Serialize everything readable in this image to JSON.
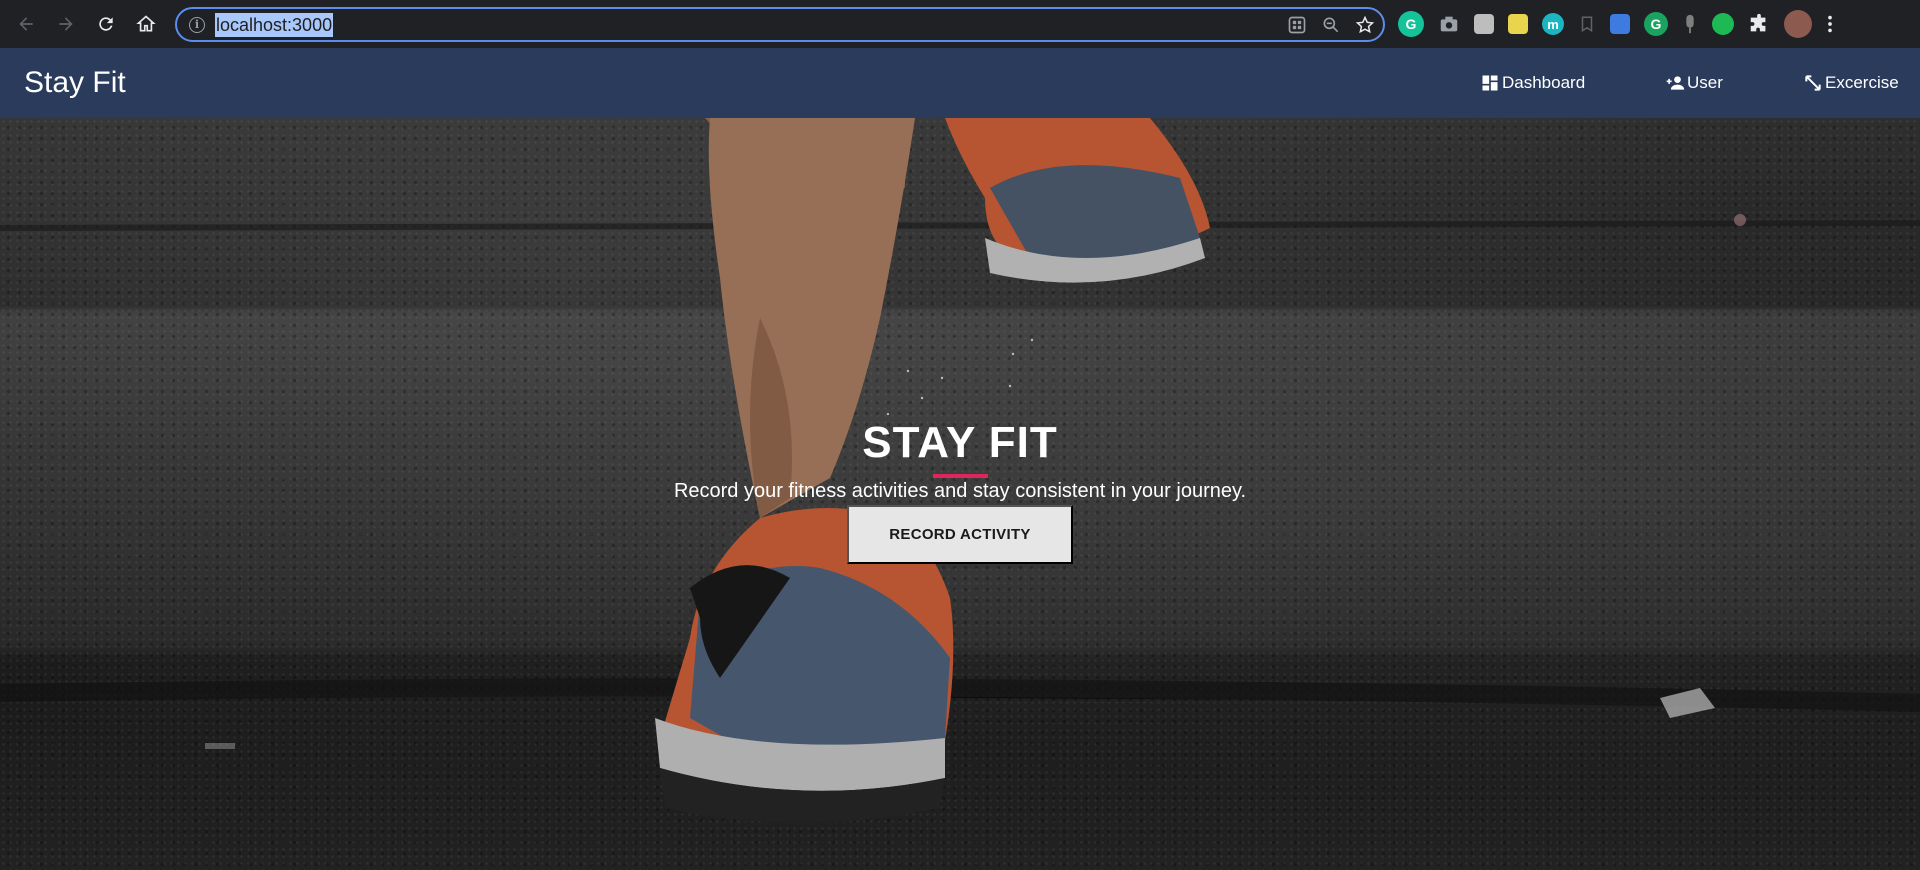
{
  "browser": {
    "url": "localhost:3000",
    "extensions": [
      "grammarly-icon",
      "camera-icon",
      "ext-square-icon",
      "ext-yellow-icon",
      "ext-m-icon",
      "bookmark-icon",
      "resize-icon",
      "grammarly-g-icon",
      "mic-icon",
      "spotify-icon",
      "puzzle-icon",
      "profile-avatar",
      "kebab-menu-icon"
    ]
  },
  "navbar": {
    "brand": "Stay Fit",
    "links": [
      {
        "label": "Dashboard",
        "icon": "dashboard-icon"
      },
      {
        "label": "User",
        "icon": "person-add-icon"
      },
      {
        "label": "Excercise",
        "icon": "fitness-icon"
      }
    ]
  },
  "hero": {
    "title": "STAY FIT",
    "subtitle": "Record your fitness activities and stay consistent in your journey.",
    "button_label": "RECORD ACTIVITY"
  },
  "colors": {
    "navbar_bg": "#2b3b5c",
    "accent_underline": "#e0245e",
    "omnibox_border": "#5b8def",
    "button_bg": "#e6e6e6"
  }
}
